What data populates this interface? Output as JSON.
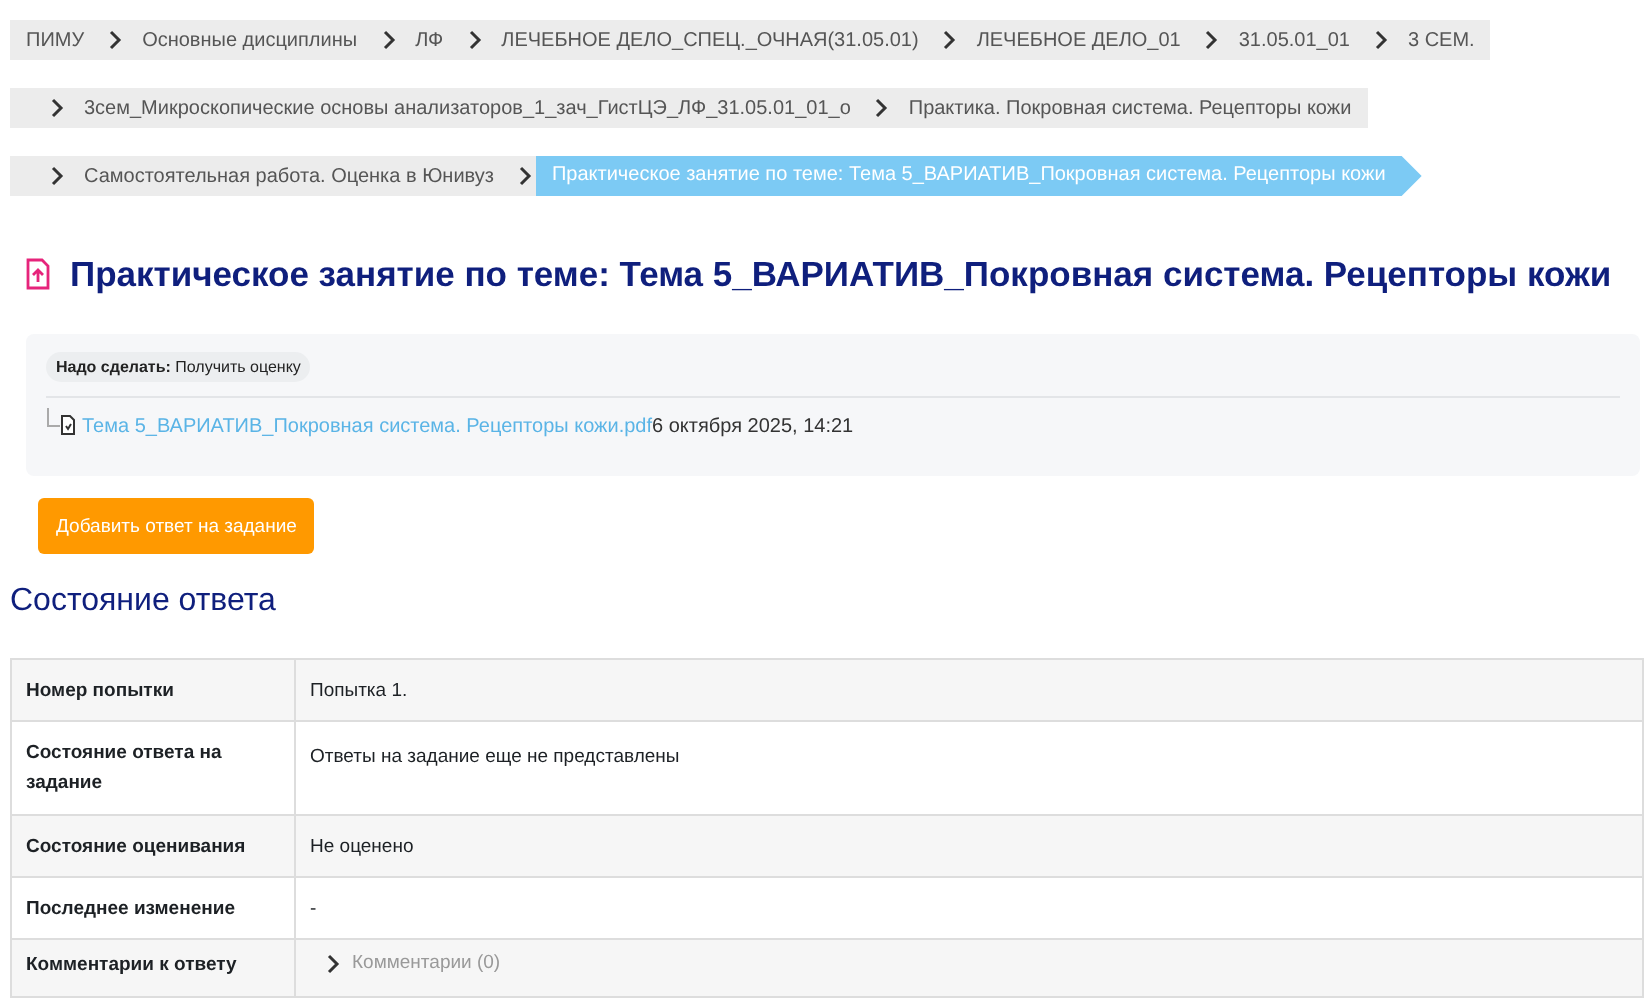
{
  "breadcrumbs": [
    {
      "items": [
        {
          "label": "ПИМУ",
          "selected": false
        },
        {
          "label": "Основные дисциплины",
          "selected": false
        },
        {
          "label": "ЛФ",
          "selected": false
        },
        {
          "label": "ЛЕЧЕБНОЕ ДЕЛО_СПЕЦ._ОЧНАЯ(31.05.01)",
          "selected": false
        },
        {
          "label": "ЛЕЧЕБНОЕ ДЕЛО_01",
          "selected": false
        },
        {
          "label": "31.05.01_01",
          "selected": false
        },
        {
          "label": "3 СЕМ.",
          "selected": false
        }
      ]
    },
    {
      "items": [
        {
          "label": "3сем_Микроскопические основы анализаторов_1_зач_ГистЦЭ_ЛФ_31.05.01_01_о",
          "selected": false
        },
        {
          "label": "Практика. Покровная система. Рецепторы кожи",
          "selected": false
        }
      ]
    },
    {
      "items": [
        {
          "label": "Самостоятельная работа. Оценка в Юнивуз",
          "selected": false
        },
        {
          "label": "Практическое занятие по теме: Тема 5_ВАРИАТИВ_Покровная система. Рецепторы кожи",
          "selected": true
        }
      ]
    }
  ],
  "title": "Практическое занятие по теме: Тема 5_ВАРИАТИВ_Покровная система. Рецепторы кожи",
  "todo": {
    "label": "Надо сделать:",
    "value": "Получить оценку"
  },
  "file": {
    "name": "Тема 5_ВАРИАТИВ_Покровная система. Рецепторы кожи.pdf",
    "date": "6 октября 2025, 14:21"
  },
  "add_button": "Добавить ответ на задание",
  "status_heading": "Состояние ответа",
  "status_rows": [
    {
      "label": "Номер попытки",
      "value": "Попытка 1."
    },
    {
      "label": "Состояние ответа на задание",
      "value": "Ответы на задание еще не представлены"
    },
    {
      "label": "Состояние оценивания",
      "value": "Не оценено"
    },
    {
      "label": "Последнее изменение",
      "value": "-"
    },
    {
      "label": "Комментарии к ответу",
      "value": "Комментарии (0)",
      "kind": "comments"
    }
  ]
}
